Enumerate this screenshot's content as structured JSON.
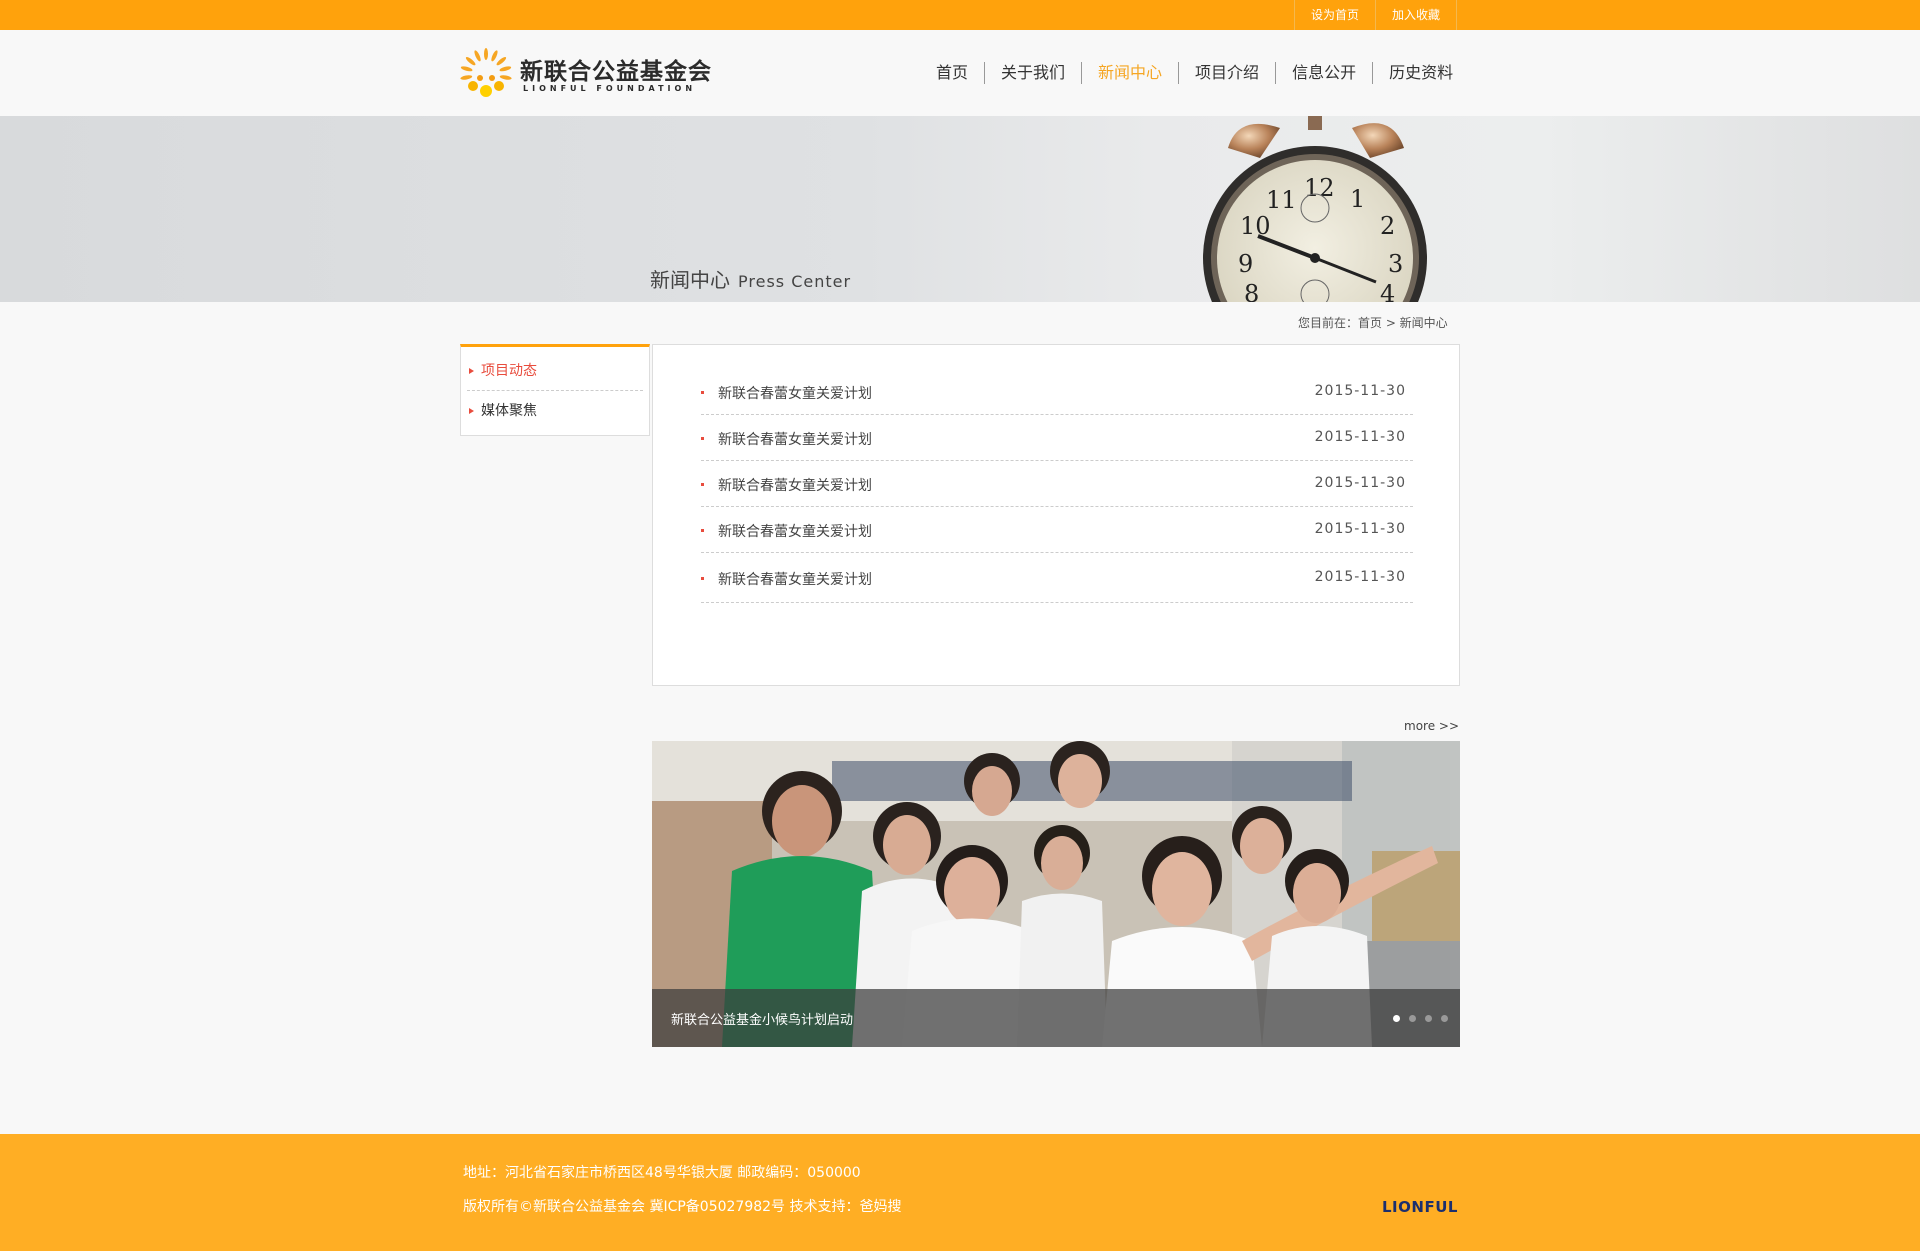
{
  "topbar": {
    "set_home": "设为首页",
    "bookmark": "加入收藏"
  },
  "logo": {
    "cn": "新联合公益基金会",
    "en": "LIONFUL FOUNDATION"
  },
  "nav": {
    "items": [
      "首页",
      "关于我们",
      "新闻中心",
      "项目介绍",
      "信息公开",
      "历史资料"
    ],
    "active": "新闻中心"
  },
  "banner": {
    "title_cn": "新闻中心",
    "title_en": "Press Center"
  },
  "breadcrumb": {
    "text": "您目前在：首页 > 新闻中心"
  },
  "sidebar": {
    "items": [
      {
        "label": "项目动态",
        "active": true
      },
      {
        "label": "媒体聚焦",
        "active": false
      }
    ]
  },
  "news": {
    "items": [
      {
        "title": "新联合春蕾女童关爱计划",
        "date": "2015-11-30"
      },
      {
        "title": "新联合春蕾女童关爱计划",
        "date": "2015-11-30"
      },
      {
        "title": "新联合春蕾女童关爱计划",
        "date": "2015-11-30"
      },
      {
        "title": "新联合春蕾女童关爱计划",
        "date": "2015-11-30"
      },
      {
        "title": "新联合春蕾女童关爱计划",
        "date": "2015-11-30"
      }
    ],
    "more": "more >>"
  },
  "slideshow": {
    "caption": "新联合公益基金小候鸟计划启动",
    "slide_count": 4,
    "active_slide": 1
  },
  "footer": {
    "address": "地址：河北省石家庄市桥西区48号华银大厦     邮政编码：050000",
    "copyright": "版权所有©新联合公益基金会 冀ICP备05027982号 技术支持：爸妈搜",
    "brand": "LIONFUL"
  },
  "colors": {
    "accent": "#ffa20c",
    "footer": "#ffae24",
    "active_red": "#e84c3d",
    "brand_blue": "#1c2f6e"
  }
}
